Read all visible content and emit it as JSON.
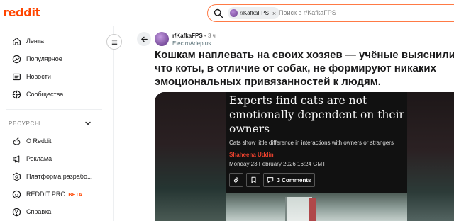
{
  "header": {
    "logo": "reddit",
    "search": {
      "chip_label": "r/KafkaFPS",
      "chip_close": "×",
      "placeholder": "Поиск в r/KafkaFPS"
    }
  },
  "sidebar": {
    "items": [
      {
        "label": "Лента",
        "icon": "home-icon"
      },
      {
        "label": "Популярное",
        "icon": "popular-icon"
      },
      {
        "label": "Новости",
        "icon": "news-icon"
      },
      {
        "label": "Сообщества",
        "icon": "communities-icon"
      }
    ],
    "section_title": "РЕСУРСЫ",
    "resources": [
      {
        "label": "О Reddit",
        "icon": "reddit-alien-icon"
      },
      {
        "label": "Реклама",
        "icon": "megaphone-icon"
      },
      {
        "label": "Платформа разрабо...",
        "icon": "developer-platform-icon"
      },
      {
        "label": "REDDIT PRO",
        "badge": "BETA",
        "icon": "reddit-pro-icon"
      },
      {
        "label": "Справка",
        "icon": "help-icon"
      }
    ]
  },
  "post": {
    "subreddit": "r/KafkaFPS",
    "time": "• 3 ч",
    "author": "ElectroAdeptus",
    "title": "Кошкам наплевать на своих хозяев — учёные выяснили, что коты, в отличие от собак, не формируют никаких эмоциональных привязанностей к людям.",
    "article": {
      "headline": "Experts find cats are not emotionally dependent on their owners",
      "subheadline": "Cats show little difference in interactions with owners or strangers",
      "author": "Shaheena Uddin",
      "date": "Monday 23 February 2026 16:24 GMT",
      "comments_label": "3 Comments"
    }
  },
  "colors": {
    "brand": "#ff4500",
    "search_border": "#ff7a45",
    "author_red": "#e8412d"
  }
}
